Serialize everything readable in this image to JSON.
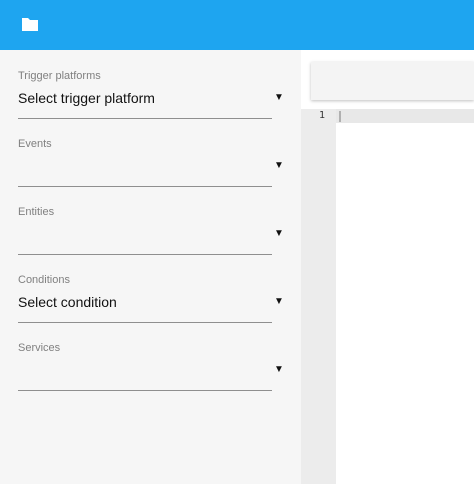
{
  "header": {
    "icon": "folder-icon",
    "color": "#1ea5f0"
  },
  "fields": [
    {
      "label": "Trigger platforms",
      "value": "Select trigger platform"
    },
    {
      "label": "Events",
      "value": ""
    },
    {
      "label": "Entities",
      "value": ""
    },
    {
      "label": "Conditions",
      "value": "Select condition"
    },
    {
      "label": "Services",
      "value": ""
    }
  ],
  "dropdown_icon": "▼",
  "editor": {
    "line_number": "1"
  }
}
